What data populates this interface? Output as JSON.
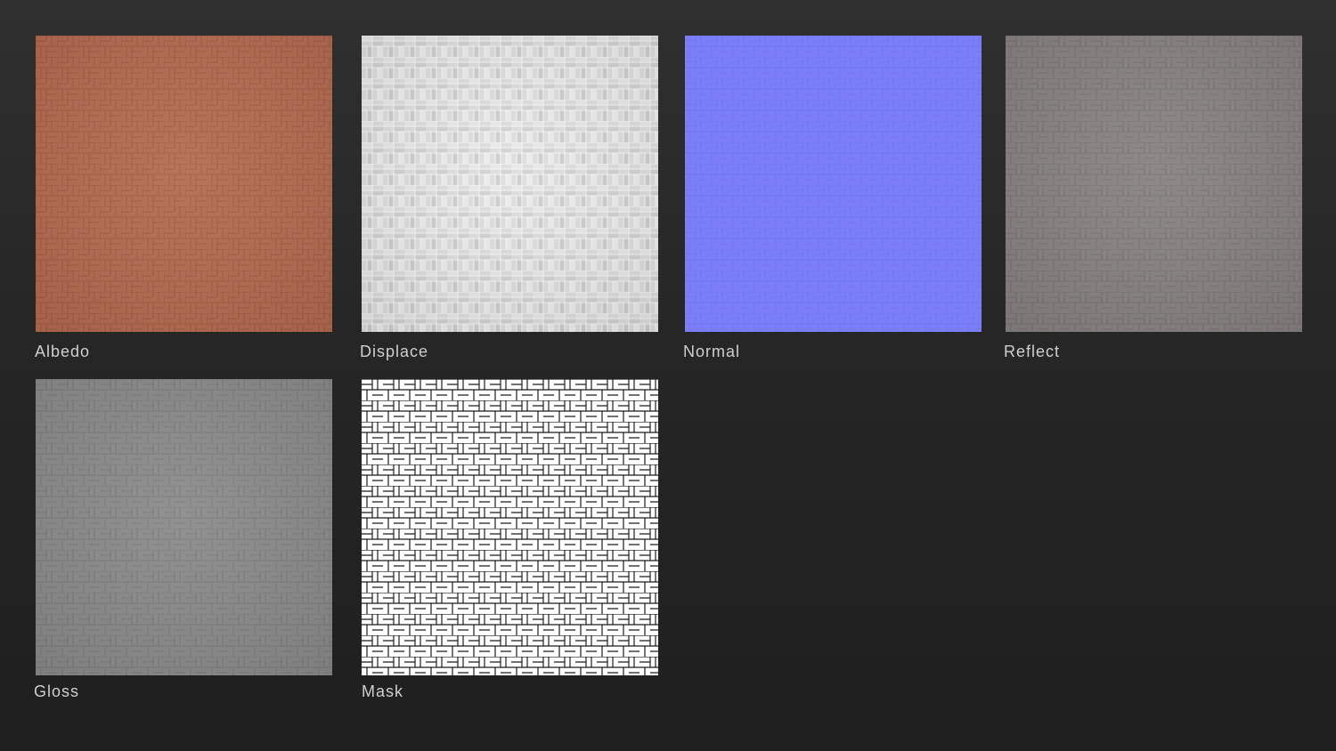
{
  "maps": {
    "albedo": {
      "label": "Albedo",
      "base_color": "#b46a50",
      "line_color": "#8f4f3a"
    },
    "displace": {
      "label": "Displace",
      "base_color": "#dedede",
      "line_color": "#f4f4f4"
    },
    "normal": {
      "label": "Normal",
      "base_color": "#7b7ef7",
      "line_color": "#6d70ec"
    },
    "reflect": {
      "label": "Reflect",
      "base_color": "#878281",
      "line_color": "#6f6b6a"
    },
    "gloss": {
      "label": "Gloss",
      "base_color": "#8a8a8a",
      "line_color": "#747474"
    },
    "mask": {
      "label": "Mask",
      "base_color": "#ffffff",
      "line_color": "#1a1a1a"
    }
  },
  "colors": {
    "background": "#272727",
    "label_text": "#cfcfcf"
  }
}
